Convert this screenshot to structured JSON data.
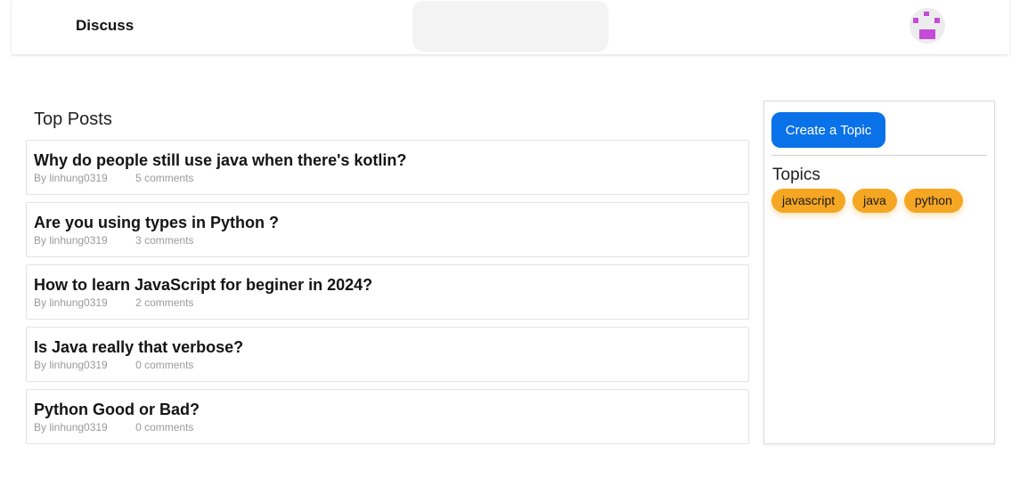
{
  "header": {
    "brand": "Discuss",
    "search_placeholder": ""
  },
  "main": {
    "section_title": "Top Posts",
    "posts": [
      {
        "title": "Why do people still use java when there's kotlin?",
        "author": "By linhung0319",
        "comments": "5 comments"
      },
      {
        "title": "Are you using types in Python ?",
        "author": "By linhung0319",
        "comments": "3 comments"
      },
      {
        "title": "How to learn JavaScript for beginer in 2024?",
        "author": "By linhung0319",
        "comments": "2 comments"
      },
      {
        "title": "Is Java really that verbose?",
        "author": "By linhung0319",
        "comments": "0 comments"
      },
      {
        "title": "Python Good or Bad?",
        "author": "By linhung0319",
        "comments": "0 comments"
      }
    ]
  },
  "sidebar": {
    "create_button": "Create a Topic",
    "topics_title": "Topics",
    "topics": [
      "javascript",
      "java",
      "python"
    ]
  },
  "colors": {
    "primary": "#0a72e8",
    "tag": "#f5a623",
    "avatar": "#c54bd6"
  },
  "icons": {
    "avatar": "identicon-avatar"
  }
}
